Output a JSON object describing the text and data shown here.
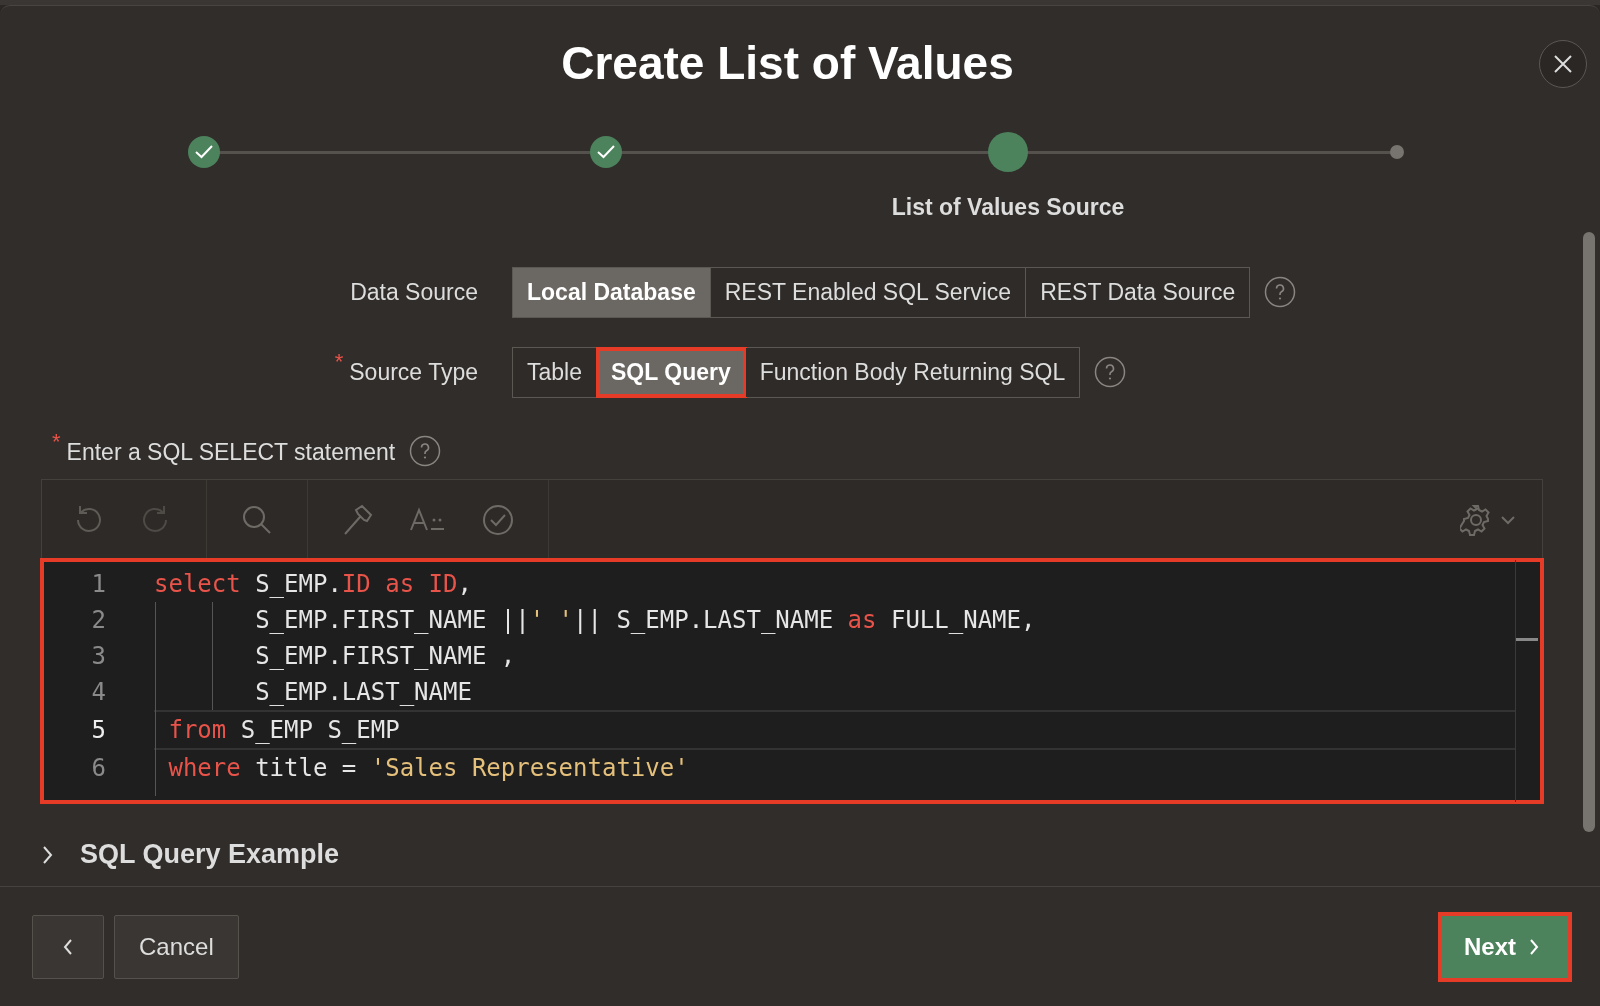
{
  "dialog": {
    "title": "Create List of Values"
  },
  "steps": [
    {
      "kind": "done"
    },
    {
      "kind": "done"
    },
    {
      "kind": "current",
      "label": "List of Values Source"
    },
    {
      "kind": "todo"
    }
  ],
  "data_source": {
    "label": "Data Source",
    "options": [
      {
        "label": "Local Database",
        "selected": true,
        "highlighted": false
      },
      {
        "label": "REST Enabled SQL Service",
        "selected": false,
        "highlighted": false
      },
      {
        "label": "REST Data Source",
        "selected": false,
        "highlighted": false
      }
    ]
  },
  "source_type": {
    "label": "Source Type",
    "required_mark": "*",
    "options": [
      {
        "label": "Table",
        "selected": false,
        "highlighted": false
      },
      {
        "label": "SQL Query",
        "selected": true,
        "highlighted": true
      },
      {
        "label": "Function Body Returning SQL",
        "selected": false,
        "highlighted": false
      }
    ]
  },
  "editor": {
    "label": "Enter a SQL SELECT statement",
    "required_mark": "*",
    "highlighted": true,
    "lines": [
      {
        "number": "1",
        "current": false,
        "tokens": [
          {
            "kind": "kw",
            "text": "select"
          },
          {
            "kind": "plain",
            "text": " S_EMP."
          },
          {
            "kind": "kw",
            "text": "ID as ID"
          },
          {
            "kind": "plain",
            "text": ","
          }
        ]
      },
      {
        "number": "2",
        "current": false,
        "tokens": [
          {
            "kind": "plain",
            "text": "       S_EMP.FIRST_NAME ||"
          },
          {
            "kind": "str",
            "text": "' '"
          },
          {
            "kind": "plain",
            "text": "|| S_EMP.LAST_NAME "
          },
          {
            "kind": "kw",
            "text": "as"
          },
          {
            "kind": "plain",
            "text": " FULL_NAME,"
          }
        ]
      },
      {
        "number": "3",
        "current": false,
        "tokens": [
          {
            "kind": "plain",
            "text": "       S_EMP.FIRST_NAME ,"
          }
        ]
      },
      {
        "number": "4",
        "current": false,
        "tokens": [
          {
            "kind": "plain",
            "text": "       S_EMP.LAST_NAME"
          }
        ]
      },
      {
        "number": "5",
        "current": true,
        "tokens": [
          {
            "kind": "kw",
            "text": " from"
          },
          {
            "kind": "plain",
            "text": " S_EMP S_EMP"
          }
        ]
      },
      {
        "number": "6",
        "current": false,
        "tokens": [
          {
            "kind": "kw",
            "text": " where"
          },
          {
            "kind": "plain",
            "text": " title = "
          },
          {
            "kind": "str",
            "text": "'Sales Representative'"
          }
        ]
      }
    ]
  },
  "example": {
    "label": "SQL Query Example",
    "expanded": false
  },
  "footer": {
    "cancel": "Cancel",
    "next": "Next",
    "next_highlighted": true
  }
}
